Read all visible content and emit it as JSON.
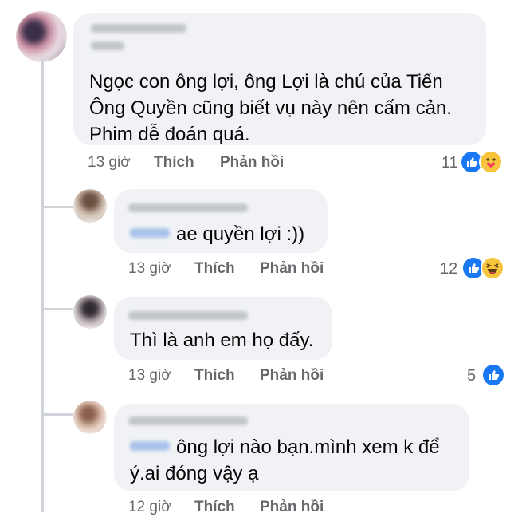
{
  "comments": [
    {
      "text_lines": [
        "Ngọc con ông lợi, ông Lợi là chú của Tiến",
        "Ông Quyền cũng biết vụ này nên cấm cản.",
        "Phim dễ đoán quá."
      ],
      "time": "13 giờ",
      "like_label": "Thích",
      "reply_label": "Phản hồi",
      "reaction_count": "11",
      "reactions": [
        "like-icon",
        "care-icon"
      ]
    }
  ],
  "replies": [
    {
      "text": "ae quyền lợi :))",
      "time": "13 giờ",
      "like_label": "Thích",
      "reply_label": "Phản hồi",
      "reaction_count": "12",
      "reactions": [
        "like-icon",
        "haha-icon"
      ]
    },
    {
      "text": "Thì là anh em họ đấy.",
      "time": "13 giờ",
      "like_label": "Thích",
      "reply_label": "Phản hồi",
      "reaction_count": "5",
      "reactions": [
        "like-icon"
      ]
    },
    {
      "text_lines": [
        "ông lợi nào bạn.mình xem k để",
        "ý.ai đóng vậy ạ"
      ],
      "time": "12 giờ",
      "like_label": "Thích",
      "reply_label": "Phản hồi"
    }
  ],
  "colors": {
    "bubble": "#f0f2f5",
    "meta": "#65676b",
    "like_blue": "#1877f2",
    "thread": "#d0d3d8"
  }
}
